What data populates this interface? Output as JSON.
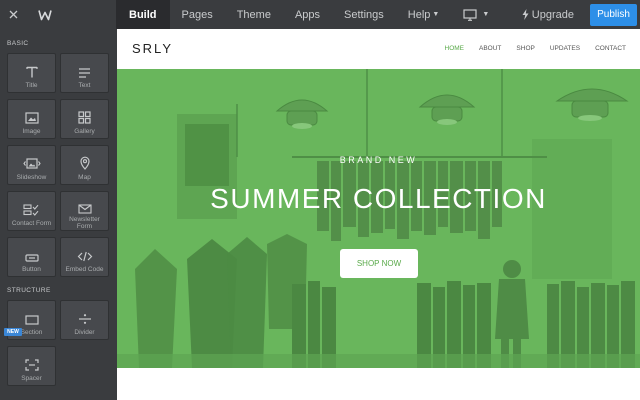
{
  "topbar": {
    "tabs": [
      {
        "label": "Build",
        "active": true
      },
      {
        "label": "Pages"
      },
      {
        "label": "Theme"
      },
      {
        "label": "Apps"
      },
      {
        "label": "Settings"
      },
      {
        "label": "Help"
      }
    ],
    "upgrade_label": "Upgrade",
    "publish_label": "Publish"
  },
  "sidebar": {
    "basic_label": "BASIC",
    "structure_label": "STRUCTURE",
    "new_badge": "NEW",
    "tiles": {
      "title": "Title",
      "text": "Text",
      "image": "Image",
      "gallery": "Gallery",
      "slideshow": "Slideshow",
      "map": "Map",
      "contact_form": "Contact Form",
      "newsletter_1": "Newsletter",
      "newsletter_2": "Form",
      "button": "Button",
      "embed_code": "Embed Code",
      "section": "Section",
      "divider": "Divider",
      "spacer": "Spacer"
    }
  },
  "site": {
    "logo": "SRLY",
    "nav": [
      "HOME",
      "ABOUT",
      "SHOP",
      "UPDATES",
      "CONTACT"
    ],
    "active_nav": "HOME",
    "hero": {
      "eyebrow": "BRAND NEW",
      "title": "SUMMER COLLECTION",
      "button": "SHOP NOW"
    }
  },
  "colors": {
    "accent_green": "#5aaa4a",
    "publish_blue": "#2d8fe8",
    "toolbar_dark": "#3a3c3f"
  }
}
